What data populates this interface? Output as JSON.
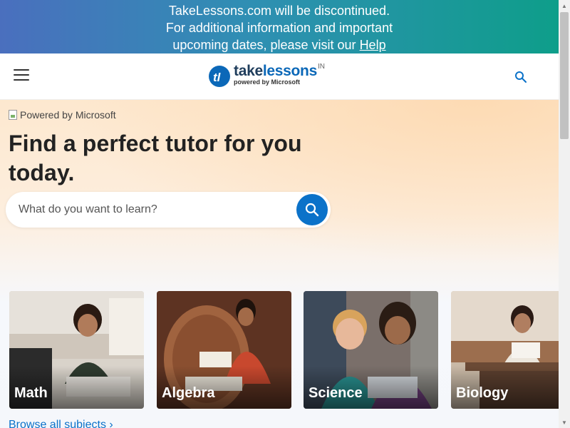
{
  "banner": {
    "line1": "TakeLessons.com will be discontinued.",
    "line2": "For additional information and important",
    "line3_prefix": "upcoming dates, please visit our ",
    "help_link": "Help"
  },
  "header": {
    "logo_take": "take",
    "logo_lessons": "lessons",
    "logo_region": "IN",
    "logo_sub": "powered by Microsoft",
    "menu_icon": "hamburger-icon",
    "search_icon": "search-icon"
  },
  "hero": {
    "powered_alt": "Powered by Microsoft",
    "title": "Find a perfect tutor for you today.",
    "search": {
      "placeholder": "What do you want to learn?"
    }
  },
  "subjects": [
    {
      "label": "Math"
    },
    {
      "label": "Algebra"
    },
    {
      "label": "Science"
    },
    {
      "label": "Biology"
    }
  ],
  "browse_link": "Browse all subjects",
  "colors": {
    "brand_blue": "#0b72c9",
    "banner_start": "#4a6fbe",
    "banner_end": "#0e9e8a"
  }
}
